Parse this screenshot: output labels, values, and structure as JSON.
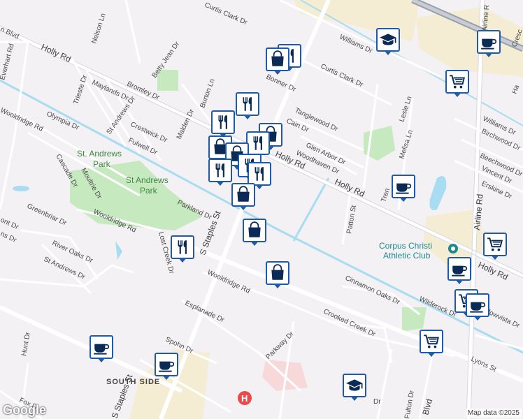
{
  "streets": {
    "curtis_clark_top": "Curtis Clark Dr",
    "holly_rd_w": "Holly Rd",
    "holly_rd_mid": "Holly Rd",
    "holly_rd_e": "Holly Rd",
    "holly_rd_far_e": "Holly Rd",
    "williams_dr": "Williams Dr",
    "williams_dr_e": "Williams Dr",
    "curtis_clark_e": "Curtis Clark Dr",
    "bonner_dr": "Bonner Dr",
    "nelson_ln": "Nelson Ln",
    "everhart_rd": "Everhart Rd",
    "blvd_top_left": "n Blvd",
    "betty_jean_dr": "Betty Jean Dr",
    "trieste_dr": "Trieste Dr",
    "maylands_dr": "Maylands Dr",
    "bromley_dr": "Bromley Dr",
    "burton_ln": "Burton Ln",
    "st_andrews_dr_n": "St Andrews Dr",
    "malden_dr": "Malden Dr",
    "crestwick_dr": "Crestwick Dr",
    "fulwell_dr": "Fulwell Dr",
    "wooldridge_rd_w": "Wooldridge Rd",
    "olympia_dr": "Olympia Dr",
    "cascade_dr": "Cascade Dr",
    "moultrie_dr": "Moultrie Dr",
    "greenbriar_dr": "Greenbriar Dr",
    "wooldridge_rd_mid": "Wooldridge Rd",
    "parkland_dr": "Parkland Dr",
    "lost_creek_dr": "Lost Creek Dr",
    "s_staples_st": "S Staples St",
    "river_oaks_dr": "River Oaks Dr",
    "st_andrews_dr_s": "St Andrews Dr",
    "wooldridge_rd_s": "Wooldridge Rd",
    "esplanade_dr": "Esplanade Dr",
    "spohn_dr": "Spohn Dr",
    "hunt_dr": "Hunt Dr",
    "fox_dr": "Fox D",
    "s_staples_st_s": "S Staples St",
    "parkway_dr": "Parkway Dr",
    "crooked_creek_dr": "Crooked Creek Dr",
    "cinnamon_oaks_dr": "Cinnamon Oaks Dr",
    "wilderock_dr": "Wilderock Dr",
    "meadowvista_dr": "eadowvista Dr",
    "lyons_st": "Lyons St",
    "fulton_dr": "Fulton Dr",
    "blvd_bottom": "Blvd",
    "ns_dr": "ns Dr",
    "ont_dr": "ont Dr",
    "dr_bottom": "Dr",
    "cain_dr": "Cain Dr",
    "tanglewood_dr": "Tanglewood Dr",
    "glen_arbor_dr": "Glen Arbor Dr",
    "woodhaven_dr": "Woodhaven Dr",
    "lesle_ln": "Lesle Ln",
    "melisa_ln": "Melisa Ln",
    "trenton": "Tren",
    "patton_st": "Patton St",
    "airline_rd": "Airline Rd",
    "airline_rd_top": "Airline R",
    "birchwood_dr": "Birchwood Dr",
    "beechwood_dr": "Beechwood Dr",
    "vincent_dr": "Vincent Dr",
    "erskine_dr": "Erskine Dr",
    "cresc": "Cresc",
    "ha": "Ha"
  },
  "places": {
    "st_andrews_park_1": "St. Andrews",
    "st_andrews_park_1b": "Park",
    "st_andrews_park_2": "St Andrews",
    "st_andrews_park_2b": "Park",
    "athletic_club_1": "Corpus Christi",
    "athletic_club_2": "Athletic Club",
    "south_side": "SOUTH SIDE"
  },
  "markers": [
    {
      "name": "shopping-bag-marker",
      "icon": "shopping-bag-icon"
    },
    {
      "name": "restaurant-marker",
      "icon": "fork-knife-icon"
    },
    {
      "name": "cafe-marker",
      "icon": "coffee-cup-icon"
    },
    {
      "name": "school-marker",
      "icon": "graduation-cap-icon"
    },
    {
      "name": "grocery-marker",
      "icon": "shopping-cart-icon"
    },
    {
      "name": "hospital-marker",
      "icon": "hospital-icon"
    }
  ],
  "colors": {
    "background": "#f3f1f4",
    "road": "#ffffff",
    "arterial": "#e0e0e6",
    "water": "#a8dcf0",
    "park": "#c7e9c0",
    "commercial": "#f4ebd0",
    "marker_border": "#1e5aa8",
    "hospital": "#e94b4b"
  },
  "footer": {
    "logo": "Google",
    "attribution": "Map data ©2025"
  }
}
